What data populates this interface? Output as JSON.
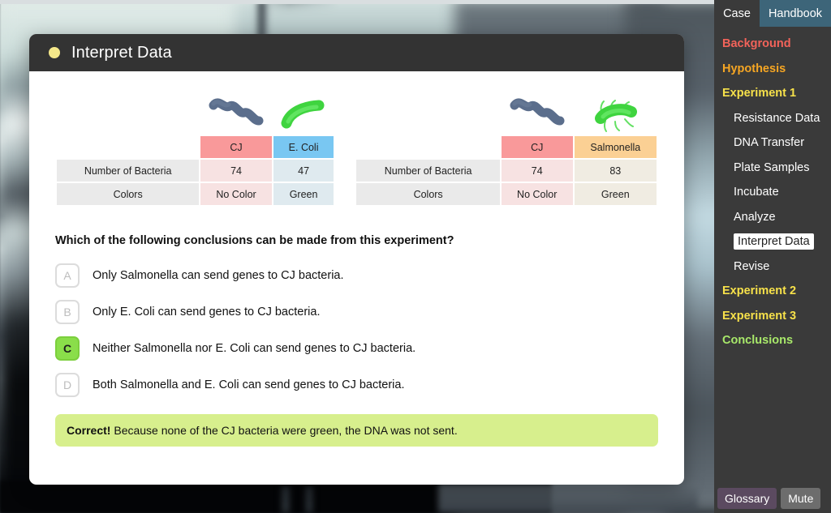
{
  "modal": {
    "title": "Interpret Data",
    "status_dot_color": "#f5e88a"
  },
  "tables": [
    {
      "name": "e-coli-experiment-table",
      "row_label_header": "",
      "columns": [
        {
          "label": "CJ",
          "icon": "spiral-bacterium-icon",
          "header_color": "#f9999a",
          "cell_color": "#f7e2e2"
        },
        {
          "label": "E. Coli",
          "icon": "green-rod-bacterium-icon",
          "header_color": "#79c7f2",
          "cell_color": "#dfeaef"
        }
      ],
      "rows": [
        {
          "label": "Number of Bacteria",
          "values": [
            "74",
            "47"
          ]
        },
        {
          "label": "Colors",
          "values": [
            "No Color",
            "Green"
          ]
        }
      ]
    },
    {
      "name": "salmonella-experiment-table",
      "row_label_header": "",
      "columns": [
        {
          "label": "CJ",
          "icon": "spiral-bacterium-icon",
          "header_color": "#f9999a",
          "cell_color": "#f7e2e2"
        },
        {
          "label": "Salmonella",
          "icon": "green-flagellated-bacterium-icon",
          "header_color": "#fbd094",
          "cell_color": "#f0ece2"
        }
      ],
      "rows": [
        {
          "label": "Number of Bacteria",
          "values": [
            "74",
            "83"
          ]
        },
        {
          "label": "Colors",
          "values": [
            "No Color",
            "Green"
          ]
        }
      ]
    }
  ],
  "question": {
    "prompt": "Which of the following conclusions can be made from this experiment?",
    "options": [
      {
        "letter": "A",
        "text": "Only Salmonella can send genes to CJ bacteria.",
        "selected": false
      },
      {
        "letter": "B",
        "text": "Only E. Coli can send genes to CJ bacteria.",
        "selected": false
      },
      {
        "letter": "C",
        "text": "Neither Salmonella nor E. Coli can send genes to CJ bacteria.",
        "selected": true
      },
      {
        "letter": "D",
        "text": "Both Salmonella and E. Coli can send genes to CJ bacteria.",
        "selected": false
      }
    ],
    "selected_letter": "C"
  },
  "feedback": {
    "prefix": "Correct!",
    "text": " Because none of the CJ bacteria were green, the DNA was not sent.",
    "background_color": "#d7ef8d"
  },
  "sidebar": {
    "tabs": [
      {
        "label": "Case",
        "active": true
      },
      {
        "label": "Handbook",
        "active": false
      }
    ],
    "nav": [
      {
        "label": "Background",
        "level": "top",
        "color": "#f2635a",
        "current": false
      },
      {
        "label": "Hypothesis",
        "level": "top",
        "color": "#f6a623",
        "current": false
      },
      {
        "label": "Experiment 1",
        "level": "top",
        "color": "#f7e14a",
        "current": false
      },
      {
        "label": "Resistance Data",
        "level": "sub",
        "color": "#ffffff",
        "current": false
      },
      {
        "label": "DNA Transfer",
        "level": "sub",
        "color": "#ffffff",
        "current": false
      },
      {
        "label": "Plate Samples",
        "level": "sub",
        "color": "#ffffff",
        "current": false
      },
      {
        "label": "Incubate",
        "level": "sub",
        "color": "#ffffff",
        "current": false
      },
      {
        "label": "Analyze",
        "level": "sub",
        "color": "#ffffff",
        "current": false
      },
      {
        "label": "Interpret Data",
        "level": "sub",
        "color": "#222222",
        "current": true
      },
      {
        "label": "Revise",
        "level": "sub",
        "color": "#ffffff",
        "current": false
      },
      {
        "label": "Experiment 2",
        "level": "top",
        "color": "#f7e14a",
        "current": false
      },
      {
        "label": "Experiment 3",
        "level": "top",
        "color": "#f7e14a",
        "current": false
      },
      {
        "label": "Conclusions",
        "level": "top",
        "color": "#a8 e8 6a",
        "current": false
      }
    ],
    "buttons": [
      {
        "label": "Glossary",
        "color": "#5b4a60"
      },
      {
        "label": "Mute",
        "color": "#6d6d6d"
      }
    ]
  }
}
